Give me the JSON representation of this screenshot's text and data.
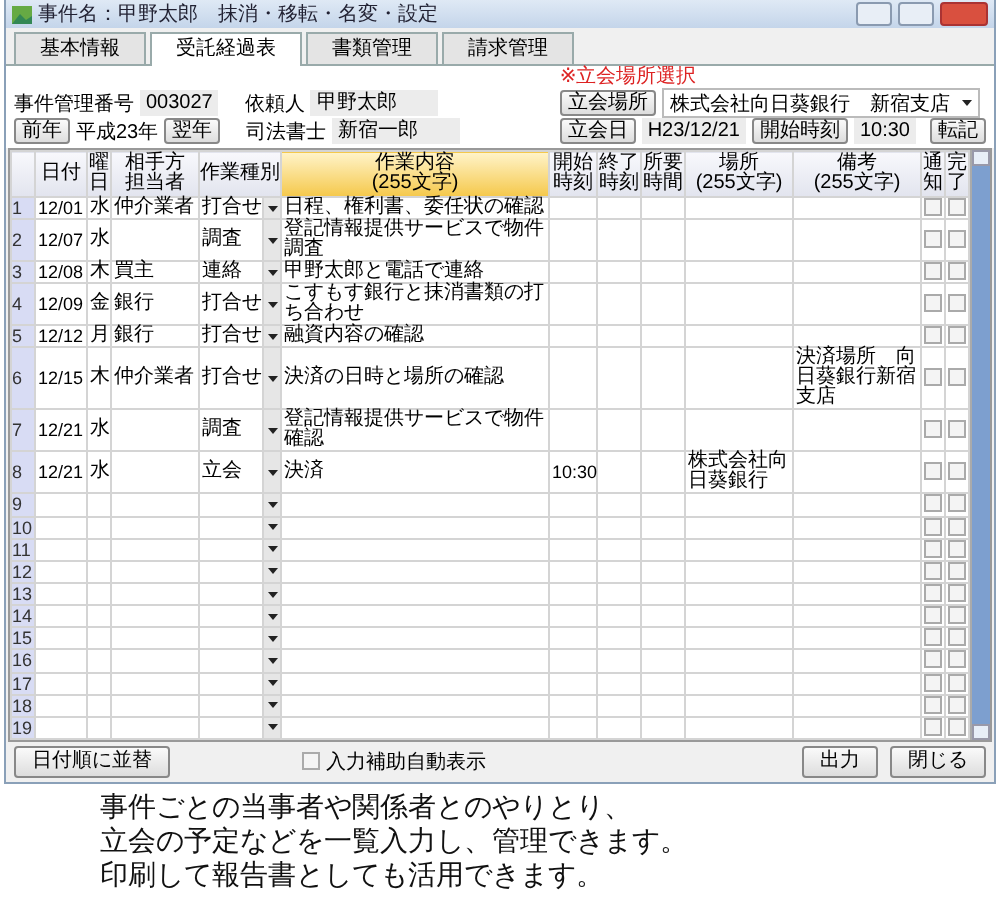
{
  "window": {
    "title": "事件名：甲野太郎　抹消・移転・名変・設定"
  },
  "tabs": [
    {
      "label": "基本情報",
      "selected": false
    },
    {
      "label": "受託経過表",
      "selected": true
    },
    {
      "label": "書類管理",
      "selected": false
    },
    {
      "label": "請求管理",
      "selected": false
    }
  ],
  "form": {
    "case_number_label": "事件管理番号",
    "case_number": "003027",
    "prev_year": "前年",
    "year": "平成23年",
    "next_year": "翌年",
    "client_label": "依頼人",
    "client": "甲野太郎",
    "scrivener_label": "司法書士",
    "scrivener": "新宿一郎",
    "place_hint": "※立会場所選択",
    "place_button": "立会場所",
    "place_value": "株式会社向日葵銀行　新宿支店",
    "date_button": "立会日",
    "date_value": "H23/12/21",
    "time_button": "開始時刻",
    "time_value": "10:30",
    "transfer_button": "転記"
  },
  "table": {
    "columns": [
      "日付",
      "曜日",
      "相手方担当者",
      "作業種別",
      "作業内容\n(255文字)",
      "開始時刻",
      "終了時刻",
      "所要時間",
      "場所\n(255文字)",
      "備考\n(255文字)",
      "通知",
      "完了"
    ],
    "rows": [
      {
        "no": "1",
        "date": "12/01",
        "weekday": "水",
        "party": "仲介業者",
        "type": "打合せ",
        "content": "日程、権利書、委任状の確認",
        "notify": false,
        "done": false
      },
      {
        "no": "2",
        "date": "12/07",
        "weekday": "水",
        "type": "調査",
        "content": "登記情報提供サービスで物件調査",
        "notify": false,
        "done": false
      },
      {
        "no": "3",
        "date": "12/08",
        "weekday": "木",
        "party": "買主",
        "type": "連絡",
        "content": "甲野太郎と電話で連絡",
        "notify": false,
        "done": false
      },
      {
        "no": "4",
        "date": "12/09",
        "weekday": "金",
        "party": "銀行",
        "type": "打合せ",
        "content": "こすもす銀行と抹消書類の打ち合わせ",
        "notify": false,
        "done": false
      },
      {
        "no": "5",
        "date": "12/12",
        "weekday": "月",
        "party": "銀行",
        "type": "打合せ",
        "content": "融資内容の確認",
        "notify": false,
        "done": false
      },
      {
        "no": "6",
        "date": "12/15",
        "weekday": "木",
        "party": "仲介業者",
        "type": "打合せ",
        "content": "決済の日時と場所の確認",
        "note": "決済場所　向日葵銀行新宿支店",
        "notify": false,
        "done": false
      },
      {
        "no": "7",
        "date": "12/21",
        "weekday": "水",
        "type": "調査",
        "content": "登記情報提供サービスで物件確認",
        "notify": false,
        "done": false
      },
      {
        "no": "8",
        "date": "12/21",
        "weekday": "水",
        "type": "立会",
        "content": "決済",
        "start": "10:30",
        "place": "株式会社向日葵銀行",
        "notify": false,
        "done": false
      },
      {
        "no": "9",
        "notify": false,
        "done": false
      },
      {
        "no": "10",
        "notify": false,
        "done": false
      },
      {
        "no": "11",
        "notify": false,
        "done": false
      },
      {
        "no": "12",
        "notify": false,
        "done": false
      },
      {
        "no": "13",
        "notify": false,
        "done": false
      },
      {
        "no": "14",
        "notify": false,
        "done": false
      },
      {
        "no": "15",
        "notify": false,
        "done": false
      },
      {
        "no": "16",
        "notify": false,
        "done": false
      },
      {
        "no": "17",
        "notify": false,
        "done": false
      },
      {
        "no": "18",
        "notify": false,
        "done": false
      },
      {
        "no": "19",
        "notify": false,
        "done": false
      }
    ]
  },
  "footer": {
    "sort_button": "日付順に並替",
    "assist_label": "入力補助自動表示",
    "assist_checked": false,
    "output_button": "出力",
    "close_button": "閉じる"
  },
  "caption": [
    "事件ごとの当事者や関係者とのやりとり、",
    "立会の予定などを一覧入力し、管理できます。",
    "印刷して報告書としても活用できます。"
  ]
}
